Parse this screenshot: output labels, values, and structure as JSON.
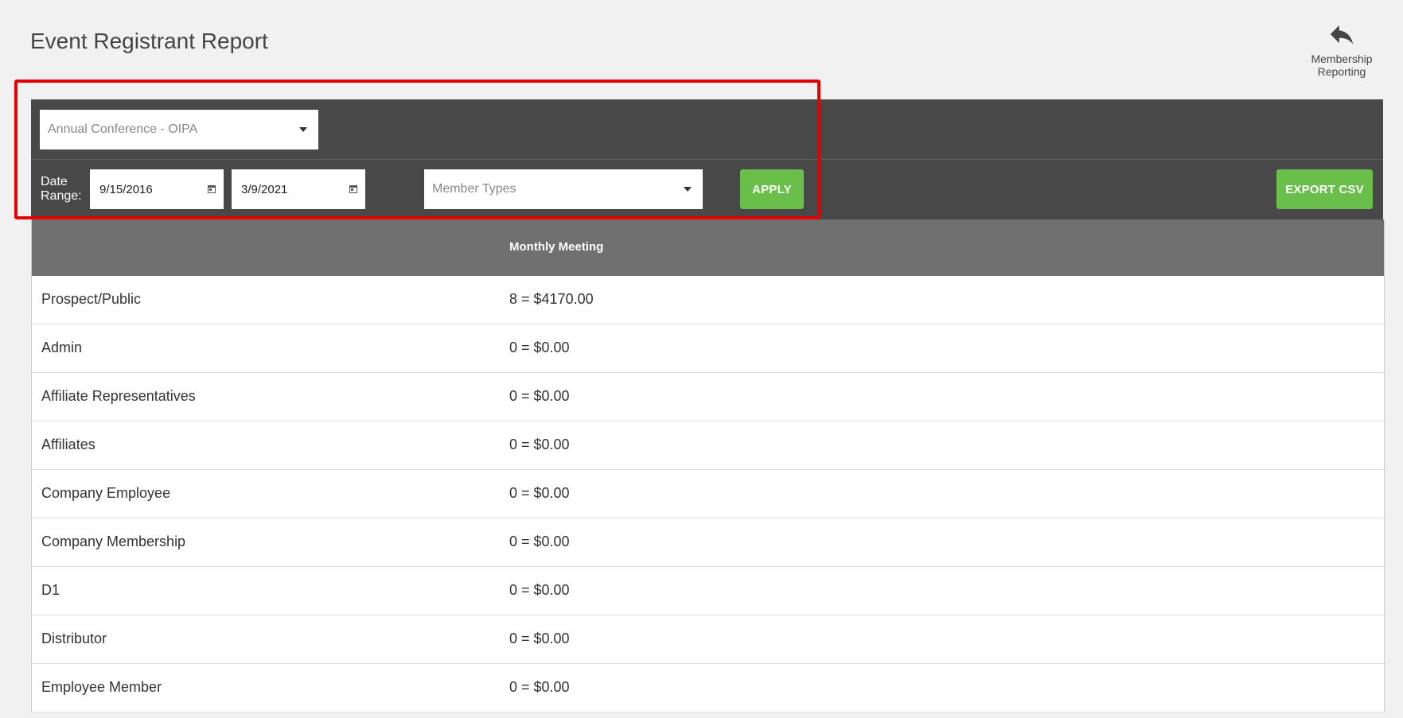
{
  "page": {
    "title": "Event Registrant Report"
  },
  "back_link": {
    "label_line1": "Membership",
    "label_line2": "Reporting",
    "icon": "reply-arrow-icon"
  },
  "filters": {
    "event_select": {
      "value": "Annual Conference - OIPA"
    },
    "date_range": {
      "label_line1": "Date",
      "label_line2": "Range:",
      "start": "9/15/2016",
      "end": "3/9/2021"
    },
    "member_types_select": {
      "placeholder": "Member Types"
    },
    "apply_label": "APPLY",
    "export_label": "EXPORT CSV"
  },
  "colors": {
    "panel_bg": "#484848",
    "header_bg": "#707070",
    "button_green": "#6abf4b",
    "highlight": "#e60000"
  },
  "table": {
    "column_header": "Monthly Meeting",
    "rows": [
      {
        "type": "Prospect/Public",
        "value": "8 = $4170.00"
      },
      {
        "type": "Admin",
        "value": "0 = $0.00"
      },
      {
        "type": "Affiliate Representatives",
        "value": "0 = $0.00"
      },
      {
        "type": "Affiliates",
        "value": "0 = $0.00"
      },
      {
        "type": "Company Employee",
        "value": "0 = $0.00"
      },
      {
        "type": "Company Membership",
        "value": "0 = $0.00"
      },
      {
        "type": "D1",
        "value": "0 = $0.00"
      },
      {
        "type": "Distributor",
        "value": "0 = $0.00"
      },
      {
        "type": "Employee Member",
        "value": "0 = $0.00"
      }
    ]
  }
}
